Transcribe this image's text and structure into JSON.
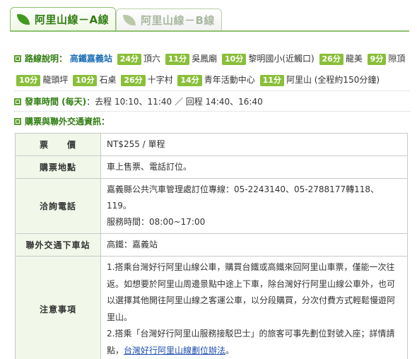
{
  "tabs": [
    {
      "label": "阿里山線－A線",
      "active": true
    },
    {
      "label": "阿里山線－B線",
      "active": false
    }
  ],
  "route": {
    "heading": "路線說明：",
    "first_stop": "高鐵嘉義站",
    "segments": [
      {
        "minutes": "24分",
        "stop": "頂六"
      },
      {
        "minutes": "11分",
        "stop": "吳鳳廟"
      },
      {
        "minutes": "10分",
        "stop": "黎明國小(近觸口)"
      },
      {
        "minutes": "26分",
        "stop": "龍美"
      },
      {
        "minutes": "9分",
        "stop": "隙頂"
      },
      {
        "minutes": "10分",
        "stop": "龍頭坪"
      },
      {
        "minutes": "10分",
        "stop": "石桌"
      },
      {
        "minutes": "26分",
        "stop": "十字村"
      },
      {
        "minutes": "14分",
        "stop": "青年活動中心"
      },
      {
        "minutes": "11分",
        "stop": "阿里山 (全程約150分鐘)"
      }
    ]
  },
  "departure": {
    "heading": "發車時間 (每天)",
    "text": "：去程 10:10、11:40 ／ 回程 14:40、16:40"
  },
  "tickets": {
    "heading": "購票與聯外交通資訊："
  },
  "table": {
    "price_label": "票　　價",
    "price_value": "NT$255 / 單程",
    "buy_label": "購票地點",
    "buy_value": "車上售票、電話訂位。",
    "phone_label": "洽詢電話",
    "phone_value_1": "嘉義縣公共汽車管理處訂位專線：05-2243140、05-2788177轉118、119。",
    "phone_value_2": "服務時間：08:00~17:00",
    "transfer_label": "聯外交通下車站",
    "transfer_value": "高鐵：嘉義站",
    "notes_label": "注意事項",
    "notes_1": "1.搭乘台灣好行阿里山線公車，購買台鐵或高鐵來回阿里山車票，僅能一次往返。如想要於阿里山周邊景點中途上下車，除台灣好行阿里山線公車外，也可以選擇其他開往阿里山線之客運公車，以分段購買，分次付費方式輕鬆慢遊阿里山。",
    "notes_2_prefix": "2.搭乘「台灣好行阿里山服務接駁巴士」的旅客可事先劃位對號入座；詳情請點，",
    "notes_2_link": "台灣好行阿里山線劃位辦法",
    "notes_2_suffix": "。"
  }
}
